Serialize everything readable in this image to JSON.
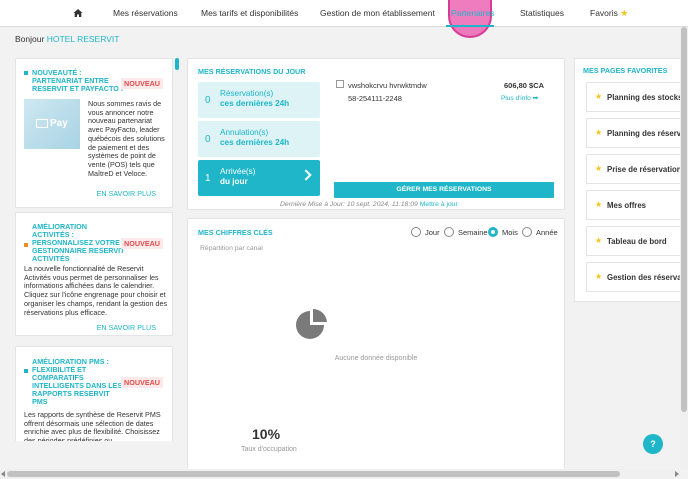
{
  "nav": {
    "items": [
      {
        "label": "Mes réservations"
      },
      {
        "label": "Mes tarifs et disponibilités"
      },
      {
        "label": "Gestion de mon établissement"
      },
      {
        "label": "Partenaires"
      },
      {
        "label": "Statistiques"
      },
      {
        "label": "Favoris"
      }
    ]
  },
  "greeting": {
    "prefix": "Bonjour",
    "hotel": "HOTEL RESERVIT"
  },
  "news": [
    {
      "title": "NOUVEAUTÉ : PARTENARIAT ENTRE RESERVIT ET PAYFACTO !",
      "badge": "NOUVEAU",
      "image_text": "Pay",
      "text": "Nous sommes ravis de vous annoncer notre nouveau partenariat avec PayFacto, leader québécois des solutions de paiement et des systèmes de point de vente (POS) tels que MaîtreD et Veloce.",
      "link": "EN SAVOIR PLUS"
    },
    {
      "title": "AMÉLIORATION ACTIVITÉS : PERSONNALISEZ VOTRE GESTIONNAIRE RESERVIT ACTIVITÉS",
      "badge": "NOUVEAU",
      "text": "La nouvelle fonctionnalité de Reservit Activités vous permet de personnaliser les informations affichées dans le calendrier. Cliquez sur l'icône engrenage pour choisir et organiser les champs, rendant la gestion des réservations plus efficace.",
      "link": "EN SAVOIR PLUS"
    },
    {
      "title": "AMÉLIORATION PMS : FLEXIBILITÉ ET COMPARATIFS INTELLIGENTS DANS LES RAPPORTS RESERVIT PMS",
      "badge": "NOUVEAU",
      "text": "Les rapports de synthèse de Reservit PMS offrent désormais une sélection de dates enrichie avec plus de flexibilité. Choisissez des périodes prédéfinies ou"
    }
  ],
  "reservations": {
    "title": "MES RÉSERVATIONS DU JOUR",
    "boxes": [
      {
        "num": "0",
        "line1": "Réservation(s)",
        "line2": "ces dernières 24h"
      },
      {
        "num": "0",
        "line1": "Annulation(s)",
        "line2": "ces dernières 24h"
      },
      {
        "num": "1",
        "line1": "Arrivée(s)",
        "line2": "du jour"
      }
    ],
    "guest": {
      "name": "vwshokcrvu hvrwktmdw",
      "price": "606,80 $CA",
      "conf": "58-254111-2248",
      "more": "Plus d'info"
    },
    "manage_label": "GÉRER MES RÉSERVATIONS",
    "update_text": "Dernière Mise à Jour: 10 sept. 2024, 11:18:09",
    "update_link": "Mettre à jour"
  },
  "figures": {
    "title": "MES CHIFFRES CLÉS",
    "periods": [
      "Jour",
      "Semaine",
      "Mois",
      "Année"
    ],
    "selected": "Mois",
    "sub_label": "Répartition par canal",
    "no_data": "Aucune donnée disponible",
    "occupancy_value": "10%",
    "occupancy_label": "Taux d'occupation"
  },
  "favorites": {
    "title": "MES PAGES FAVORITES",
    "items": [
      {
        "label": "Planning des stocks"
      },
      {
        "label": "Planning des réservations"
      },
      {
        "label": "Prise de réservation"
      },
      {
        "label": "Mes offres"
      },
      {
        "label": "Tableau de bord"
      },
      {
        "label": "Gestion des réservations"
      }
    ]
  },
  "help": {
    "label": "?"
  },
  "colors": {
    "accent": "#1fb6c9",
    "badge": "#e14b4b",
    "star": "#f5c518"
  }
}
